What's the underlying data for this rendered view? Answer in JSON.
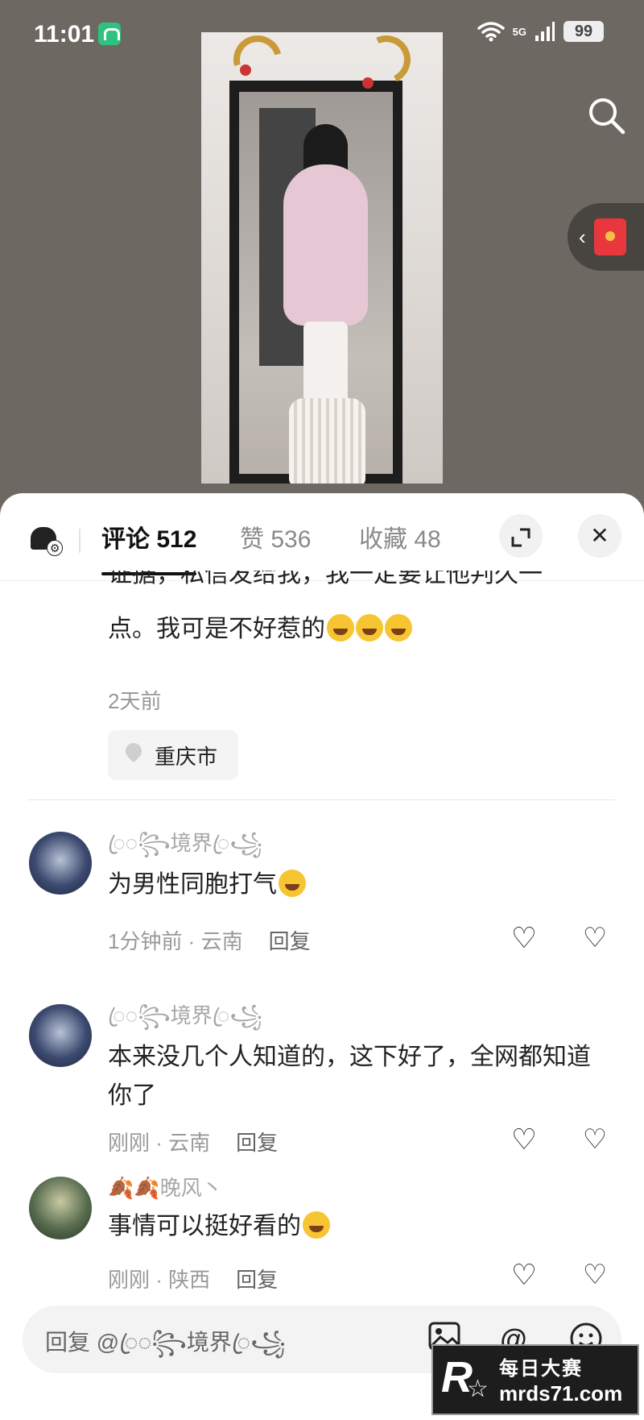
{
  "status_bar": {
    "time": "11:01",
    "network": "5G",
    "battery": "99"
  },
  "video": {
    "search_icon": "search-icon",
    "side_entry": {
      "chevron": "‹",
      "icon": "red-packet-icon"
    }
  },
  "sheet": {
    "tabs": {
      "comments": "评论 512",
      "likes": "赞 536",
      "favorites": "收藏 48"
    },
    "expand_icon": "⤢",
    "close_icon": "✕"
  },
  "top_comment": {
    "text_cut": "证据，私信发给我，我一定要让他判久一",
    "text_line2": "点。我可是不好惹的",
    "emojis": 3,
    "time": "2天前",
    "location": "重庆市"
  },
  "comments": [
    {
      "nickname": "ꦿ◌꧂境界ꦿ꧁",
      "text": "为男性同胞打气",
      "has_emoji": true,
      "time": "1分钟前 · 云南",
      "reply": "回复"
    },
    {
      "nickname": "ꦿ◌꧂境界ꦿ꧁",
      "text": "本来没几个人知道的，这下好了，全网都知道你了",
      "has_emoji": false,
      "time": "刚刚 · 云南",
      "reply": "回复"
    },
    {
      "nickname": "🍂🍂晚风丶",
      "text": "事情可以挺好看的",
      "has_emoji": true,
      "time": "刚刚 · 陕西",
      "reply": "回复"
    }
  ],
  "input": {
    "placeholder": "回复 @ꦿ◌꧂境界ꦿ꧁",
    "icons": [
      "image-icon",
      "at-icon",
      "emoji-icon"
    ]
  },
  "watermark": {
    "line1": "每日大赛",
    "line2": "mrds71.com",
    "logo": "R"
  }
}
